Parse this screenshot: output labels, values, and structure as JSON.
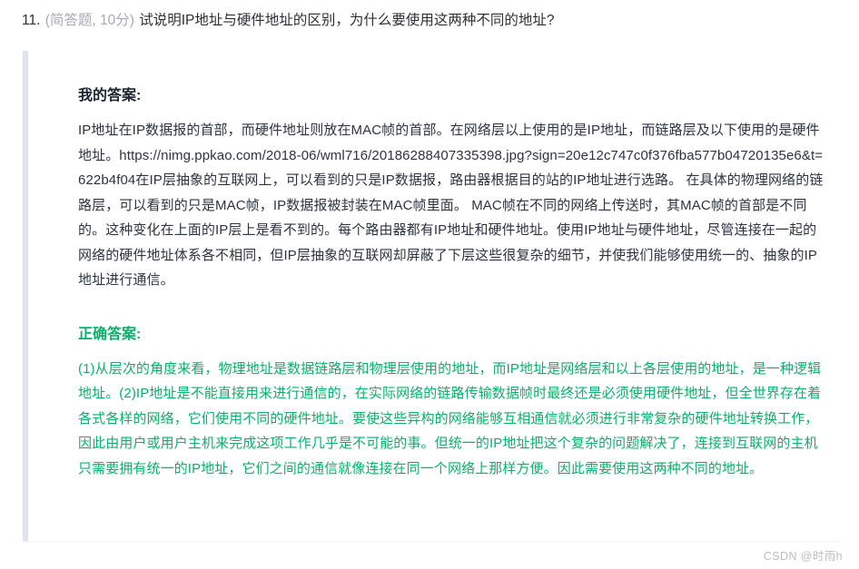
{
  "question": {
    "number": "11.",
    "meta": "(简答题, 10分)",
    "text": "试说明IP地址与硬件地址的区别，为什么要使用这两种不同的地址?"
  },
  "my_answer": {
    "title": "我的答案:",
    "text": "IP地址在IP数据报的首部，而硬件地址则放在MAC帧的首部。在网络层以上使用的是IP地址，而链路层及以下使用的是硬件地址。https://nimg.ppkao.com/2018-06/wml716/20186288407335398.jpg?sign=20e12c747c0f376fba577b04720135e6&t=622b4f04在IP层抽象的互联网上，可以看到的只是IP数据报，路由器根据目的站的IP地址进行选路。 在具体的物理网络的链路层，可以看到的只是MAC帧，IP数据报被封装在MAC帧里面。 MAC帧在不同的网络上传送时，其MAC帧的首部是不同的。这种变化在上面的IP层上是看不到的。每个路由器都有IP地址和硬件地址。使用IP地址与硬件地址，尽管连接在一起的网络的硬件地址体系各不相同，但IP层抽象的互联网却屏蔽了下层这些很复杂的细节，并使我们能够使用统一的、抽象的IP地址进行通信。"
  },
  "correct_answer": {
    "title": "正确答案:",
    "text": "(1)从层次的角度来看，物理地址是数据链路层和物理层使用的地址，而IP地址是网络层和以上各层使用的地址，是一种逻辑地址。(2)IP地址是不能直接用来进行通信的，在实际网络的链路传输数据帧时最终还是必须使用硬件地址，但全世界存在着各式各样的网络，它们使用不同的硬件地址。要使这些异构的网络能够互相通信就必须进行非常复杂的硬件地址转换工作，因此由用户或用户主机来完成这项工作几乎是不可能的事。但统一的IP地址把这个复杂的问题解决了，连接到互联网的主机只需要拥有统一的IP地址，它们之间的通信就像连接在同一个网络上那样方便。因此需要使用这两种不同的地址。"
  },
  "watermark": "CSDN @时雨h",
  "colors": {
    "correct_green": "#0bb06b",
    "panel_border": "#dfe4ed",
    "meta_gray": "#a6aab3",
    "watermark_gray": "#b9bcc2"
  }
}
